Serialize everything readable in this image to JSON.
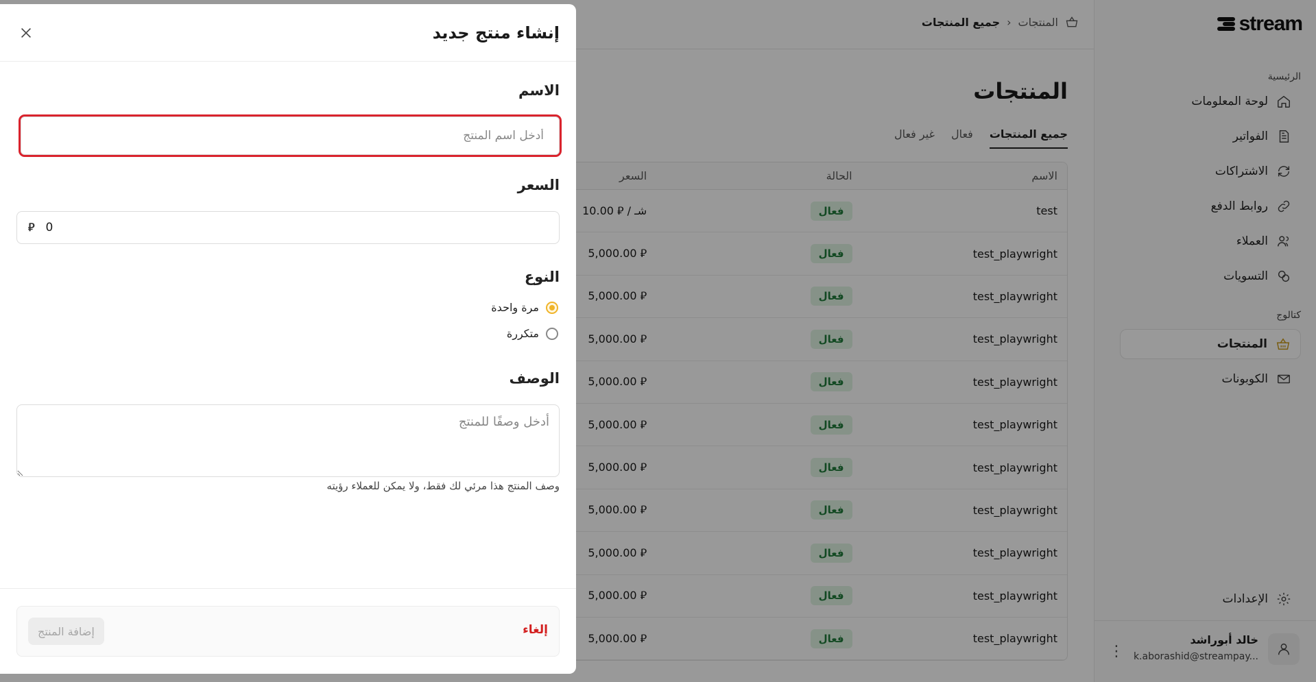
{
  "brand": {
    "name": "stream"
  },
  "breadcrumb": {
    "parent": "المنتجات",
    "current": "جميع المنتجات"
  },
  "sidebar": {
    "section_main": "الرئيسية",
    "section_catalog": "كتالوج",
    "items": [
      {
        "label": "لوحة المعلومات",
        "icon": "home-icon"
      },
      {
        "label": "الفواتير",
        "icon": "invoice-icon"
      },
      {
        "label": "الاشتراكات",
        "icon": "refresh-icon"
      },
      {
        "label": "روابط الدفع",
        "icon": "link-icon"
      },
      {
        "label": "العملاء",
        "icon": "users-icon"
      },
      {
        "label": "التسويات",
        "icon": "coins-icon"
      },
      {
        "label": "المنتجات",
        "icon": "basket-icon"
      },
      {
        "label": "الكوبونات",
        "icon": "ticket-icon"
      },
      {
        "label": "الإعدادات",
        "icon": "gear-icon"
      }
    ],
    "user": {
      "name": "خالد أبوراشد",
      "email": "k.aborashid@streampay..."
    }
  },
  "main": {
    "title": "المنتجات",
    "tabs": [
      "جميع المنتجات",
      "فعال",
      "غير فعال"
    ],
    "table": {
      "headers": [
        "الاسم",
        "الحالة",
        "السعر"
      ],
      "rows": [
        {
          "name": "test",
          "status": "فعال",
          "price": "10.00 ⃁ / شـ"
        },
        {
          "name": "test_playwright",
          "status": "فعال",
          "price": "5,000.00 ⃁"
        },
        {
          "name": "test_playwright",
          "status": "فعال",
          "price": "5,000.00 ⃁"
        },
        {
          "name": "test_playwright",
          "status": "فعال",
          "price": "5,000.00 ⃁"
        },
        {
          "name": "test_playwright",
          "status": "فعال",
          "price": "5,000.00 ⃁"
        },
        {
          "name": "test_playwright",
          "status": "فعال",
          "price": "5,000.00 ⃁"
        },
        {
          "name": "test_playwright",
          "status": "فعال",
          "price": "5,000.00 ⃁"
        },
        {
          "name": "test_playwright",
          "status": "فعال",
          "price": "5,000.00 ⃁"
        },
        {
          "name": "test_playwright",
          "status": "فعال",
          "price": "5,000.00 ⃁"
        },
        {
          "name": "test_playwright",
          "status": "فعال",
          "price": "5,000.00 ⃁"
        },
        {
          "name": "test_playwright",
          "status": "فعال",
          "price": "5,000.00 ⃁"
        }
      ]
    }
  },
  "drawer": {
    "title": "إنشاء منتج جديد",
    "name_label": "الاسم",
    "name_placeholder": "أدخل اسم المنتج",
    "price_label": "السعر",
    "price_value": "0",
    "currency": "⃁",
    "type_label": "النوع",
    "type_options": [
      {
        "label": "مرة واحدة",
        "selected": true
      },
      {
        "label": "متكررة",
        "selected": false
      }
    ],
    "desc_label": "الوصف",
    "desc_placeholder": "أدخل وصفًا للمنتج",
    "desc_hint": "وصف المنتج هذا مرئي لك فقط، ولا يمكن للعملاء رؤيته",
    "cancel_label": "إلغاء",
    "submit_label": "إضافة المنتج"
  },
  "colors": {
    "accent": "#f0b429",
    "danger": "#d31f1f",
    "highlight": "#d9232d",
    "success": "#1f7a3a"
  }
}
